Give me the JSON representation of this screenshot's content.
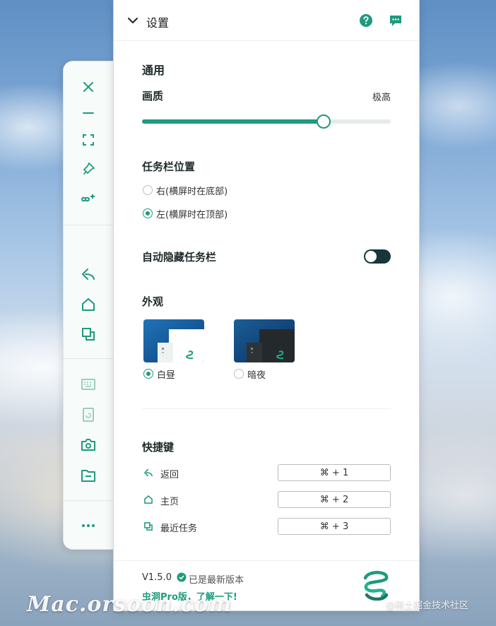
{
  "header": {
    "title": "设置",
    "help_icon": "help-circle-icon",
    "feedback_icon": "chat-bubble-icon"
  },
  "sidebar": {
    "items": [
      {
        "name": "close",
        "icon": "close-icon"
      },
      {
        "name": "minimize",
        "icon": "minus-icon"
      },
      {
        "name": "fullscreen",
        "icon": "fullscreen-icon"
      },
      {
        "name": "pin",
        "icon": "pin-icon"
      },
      {
        "name": "add-connection",
        "icon": "infinity-add-icon"
      },
      {
        "name": "back",
        "icon": "back-arrow-icon"
      },
      {
        "name": "home",
        "icon": "home-icon"
      },
      {
        "name": "recent-tasks",
        "icon": "recent-tasks-icon"
      },
      {
        "name": "keyboard",
        "icon": "keyboard-icon"
      },
      {
        "name": "rotate",
        "icon": "rotate-screen-icon"
      },
      {
        "name": "screenshot",
        "icon": "camera-icon"
      },
      {
        "name": "files",
        "icon": "folder-icon"
      },
      {
        "name": "more",
        "icon": "more-dots-icon"
      }
    ]
  },
  "general": {
    "section_title": "通用",
    "quality_label": "画质",
    "quality_value": "极高",
    "quality_level_fraction": 0.73
  },
  "taskbar": {
    "label": "任务栏位置",
    "options": [
      {
        "label": "右(横屏时在底部)",
        "checked": false
      },
      {
        "label": "左(横屏时在顶部)",
        "checked": true
      }
    ]
  },
  "autohide": {
    "label": "自动隐藏任务栏",
    "enabled": true
  },
  "appearance": {
    "label": "外观",
    "options": [
      {
        "label": "白昼",
        "checked": true
      },
      {
        "label": "暗夜",
        "checked": false
      }
    ]
  },
  "shortcuts": {
    "title": "快捷键",
    "items": [
      {
        "icon": "back-arrow-icon",
        "label": "返回",
        "keys": "⌘ + 1"
      },
      {
        "icon": "home-icon",
        "label": "主页",
        "keys": "⌘ + 2"
      },
      {
        "icon": "recent-tasks-icon",
        "label": "最近任务",
        "keys": "⌘ + 3"
      }
    ]
  },
  "footer": {
    "version": "V1.5.0",
    "status": "已是最新版本",
    "promo_link": "虫洞Pro版，了解一下!",
    "logo_icon": "wormhole-logo-icon"
  },
  "watermarks": {
    "left": "Mac.orsoon.com",
    "right": "@稀土掘金技术社区"
  },
  "colors": {
    "accent": "#1f9a7e",
    "toggle_on": "#16363a"
  }
}
